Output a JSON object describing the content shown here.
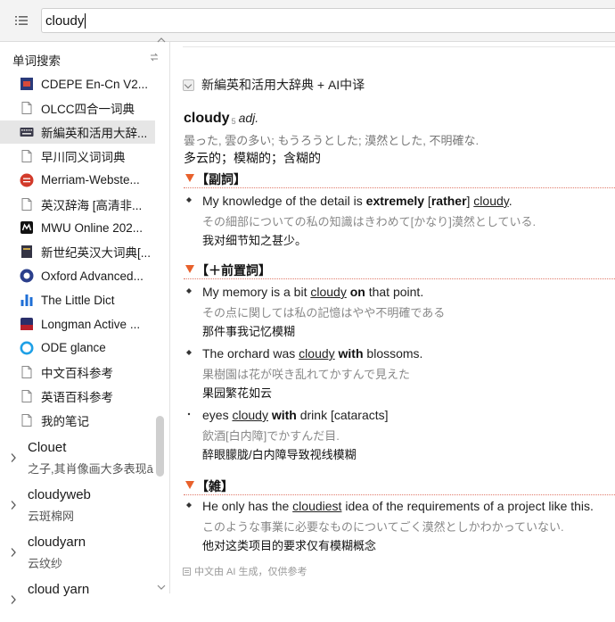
{
  "search": {
    "value": "cloudy"
  },
  "sidebar": {
    "title": "单词搜索",
    "dictionaries": [
      {
        "label": "CDEPE En-Cn V2...",
        "icon": "cdepe-icon",
        "color": "#2a3a7a"
      },
      {
        "label": "OLCC四合一词典",
        "icon": "document-icon",
        "color": "#888888"
      },
      {
        "label": "新編英和活用大辞...",
        "icon": "keyboard-icon",
        "color": "#3a3a4a"
      },
      {
        "label": "早川同义词词典",
        "icon": "document-icon",
        "color": "#888888"
      },
      {
        "label": "Merriam-Webste...",
        "icon": "merriam-webster-icon",
        "color": "#d23a2a"
      },
      {
        "label": "英汉辞海 [高清非...",
        "icon": "document-icon",
        "color": "#888888"
      },
      {
        "label": "MWU Online 202...",
        "icon": "mwu-icon",
        "color": "#111111"
      },
      {
        "label": "新世纪英汉大词典[...",
        "icon": "book-icon",
        "color": "#333344"
      },
      {
        "label": "Oxford Advanced...",
        "icon": "oxford-icon",
        "color": "#2b3f8c"
      },
      {
        "label": "The Little Dict",
        "icon": "bar-chart-icon",
        "color": "#1f6fd6"
      },
      {
        "label": "Longman Active ...",
        "icon": "longman-icon",
        "color": "#b8202a"
      },
      {
        "label": "ODE glance",
        "icon": "ode-icon",
        "color": "#1ea0e6"
      },
      {
        "label": "中文百科参考",
        "icon": "document-icon",
        "color": "#888888"
      },
      {
        "label": "英语百科参考",
        "icon": "document-icon",
        "color": "#888888"
      },
      {
        "label": "我的笔记",
        "icon": "document-icon",
        "color": "#888888"
      }
    ],
    "words": [
      {
        "word": "Clouet",
        "subtitle": "之子,其肖像画大多表现ā"
      },
      {
        "word": "cloudyweb",
        "subtitle": "云斑棉网"
      },
      {
        "word": "cloudyarn",
        "subtitle": "云纹纱"
      },
      {
        "word": "cloud yarn",
        "subtitle": ""
      }
    ]
  },
  "main": {
    "dictionary_title": "新編英和活用大辞典 + AI中译",
    "headword": "cloudy",
    "homograph": "5",
    "pos": "adj.",
    "ja_definition": "曇った, 雲の多い; もうろうとした; 漠然とした, 不明確な.",
    "zh_definition": "多云的；模糊的；含糊的",
    "sections": [
      {
        "title": "【副詞】",
        "examples": [
          {
            "en": [
              {
                "t": "My knowledge of the detail is "
              },
              {
                "t": "extremely",
                "s": "bold"
              },
              {
                "t": " ["
              },
              {
                "t": "rather",
                "s": "bold"
              },
              {
                "t": "] "
              },
              {
                "t": "cloudy",
                "s": "ul"
              },
              {
                "t": "."
              }
            ],
            "ja": "その細部についての私の知識はきわめて[かなり]漠然としている.",
            "zh": "我对细节知之甚少。"
          }
        ]
      },
      {
        "title": "【＋前置詞】",
        "examples": [
          {
            "en": [
              {
                "t": "My memory is a bit "
              },
              {
                "t": "cloudy",
                "s": "ul"
              },
              {
                "t": " "
              },
              {
                "t": "on",
                "s": "bold"
              },
              {
                "t": " that point."
              }
            ],
            "ja": "その点に関しては私の記憶はやや不明確である",
            "zh": "那件事我记忆模糊"
          },
          {
            "en": [
              {
                "t": "The orchard was "
              },
              {
                "t": "cloudy",
                "s": "ul"
              },
              {
                "t": " "
              },
              {
                "t": "with",
                "s": "bold"
              },
              {
                "t": " blossoms."
              }
            ],
            "ja": "果樹園は花が咲き乱れてかすんで見えた",
            "zh": "果园繁花如云"
          },
          {
            "en": [
              {
                "t": "eyes "
              },
              {
                "t": "cloudy",
                "s": "ul"
              },
              {
                "t": " "
              },
              {
                "t": "with",
                "s": "bold"
              },
              {
                "t": " drink [cataracts]"
              }
            ],
            "ja": "飲酒[白内障]でかすんだ目.",
            "zh": "醉眼朦胧/白内障导致视线模糊",
            "bullet": "dot"
          }
        ]
      },
      {
        "title": "【雑】",
        "examples": [
          {
            "en": [
              {
                "t": "He only has the "
              },
              {
                "t": "cloudiest",
                "s": "ul"
              },
              {
                "t": " idea of the requirements of a project like this."
              }
            ],
            "ja": "このような事業に必要なものについてごく漠然としかわかっていない.",
            "zh": "他对这类项目的要求仅有模糊概念"
          }
        ]
      }
    ],
    "footer_note": "中文由 AI 生成，仅供参考"
  }
}
